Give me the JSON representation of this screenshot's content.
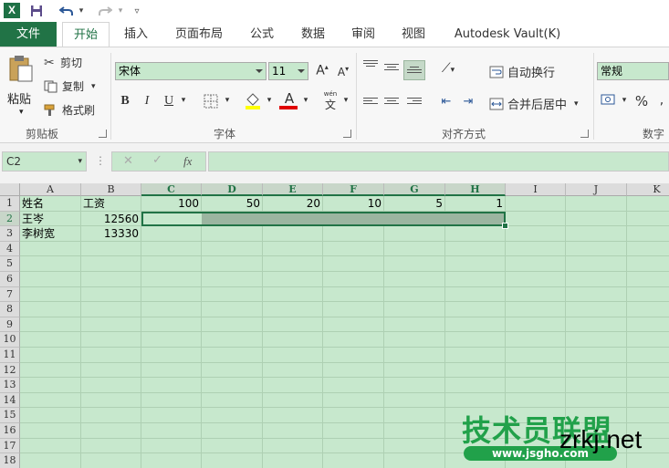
{
  "app": {
    "logo": "X"
  },
  "quick_access": {
    "save_icon": "save-icon",
    "undo_icon": "undo-icon",
    "redo_icon": "redo-icon"
  },
  "tabs": [
    {
      "label": "文件"
    },
    {
      "label": "开始"
    },
    {
      "label": "插入"
    },
    {
      "label": "页面布局"
    },
    {
      "label": "公式"
    },
    {
      "label": "数据"
    },
    {
      "label": "审阅"
    },
    {
      "label": "视图"
    },
    {
      "label": "Autodesk Vault(K)"
    }
  ],
  "clipboard": {
    "paste": "粘贴",
    "cut": "剪切",
    "copy": "复制",
    "format_painter": "格式刷",
    "group": "剪贴板"
  },
  "font": {
    "name": "宋体",
    "size": "11",
    "bold": "B",
    "italic": "I",
    "underline": "U",
    "grow": "A",
    "shrink": "A",
    "color_letter": "A",
    "phonetic_top": "wén",
    "phonetic_bottom": "文",
    "group": "字体"
  },
  "alignment": {
    "wrap": "自动换行",
    "merge": "合并后居中",
    "group": "对齐方式"
  },
  "number": {
    "format": "常规",
    "percent": "%",
    "group": "数字"
  },
  "formula_bar": {
    "name_box": "C2",
    "fx": "fx",
    "more": "⋮"
  },
  "colors": {
    "accent": "#217346",
    "grid_bg": "#c7e8cd",
    "selection": "#9bb5a0"
  },
  "columns": [
    "A",
    "B",
    "C",
    "D",
    "E",
    "F",
    "G",
    "H",
    "I",
    "J",
    "K"
  ],
  "rows": [
    "1",
    "2",
    "3",
    "4",
    "5",
    "6",
    "7",
    "8",
    "9",
    "10",
    "11",
    "12",
    "13",
    "14",
    "15",
    "16",
    "17",
    "18"
  ],
  "cells": {
    "A1": "姓名",
    "B1": "工资",
    "C1": "100",
    "D1": "50",
    "E1": "20",
    "F1": "10",
    "G1": "5",
    "H1": "1",
    "A2": "王岑",
    "B2": "12560",
    "A3": "李树宽",
    "B3": "13330"
  },
  "watermark": {
    "title": "技术员联盟",
    "site": "www.jsgho.com",
    "brand": "zrkj.net"
  }
}
